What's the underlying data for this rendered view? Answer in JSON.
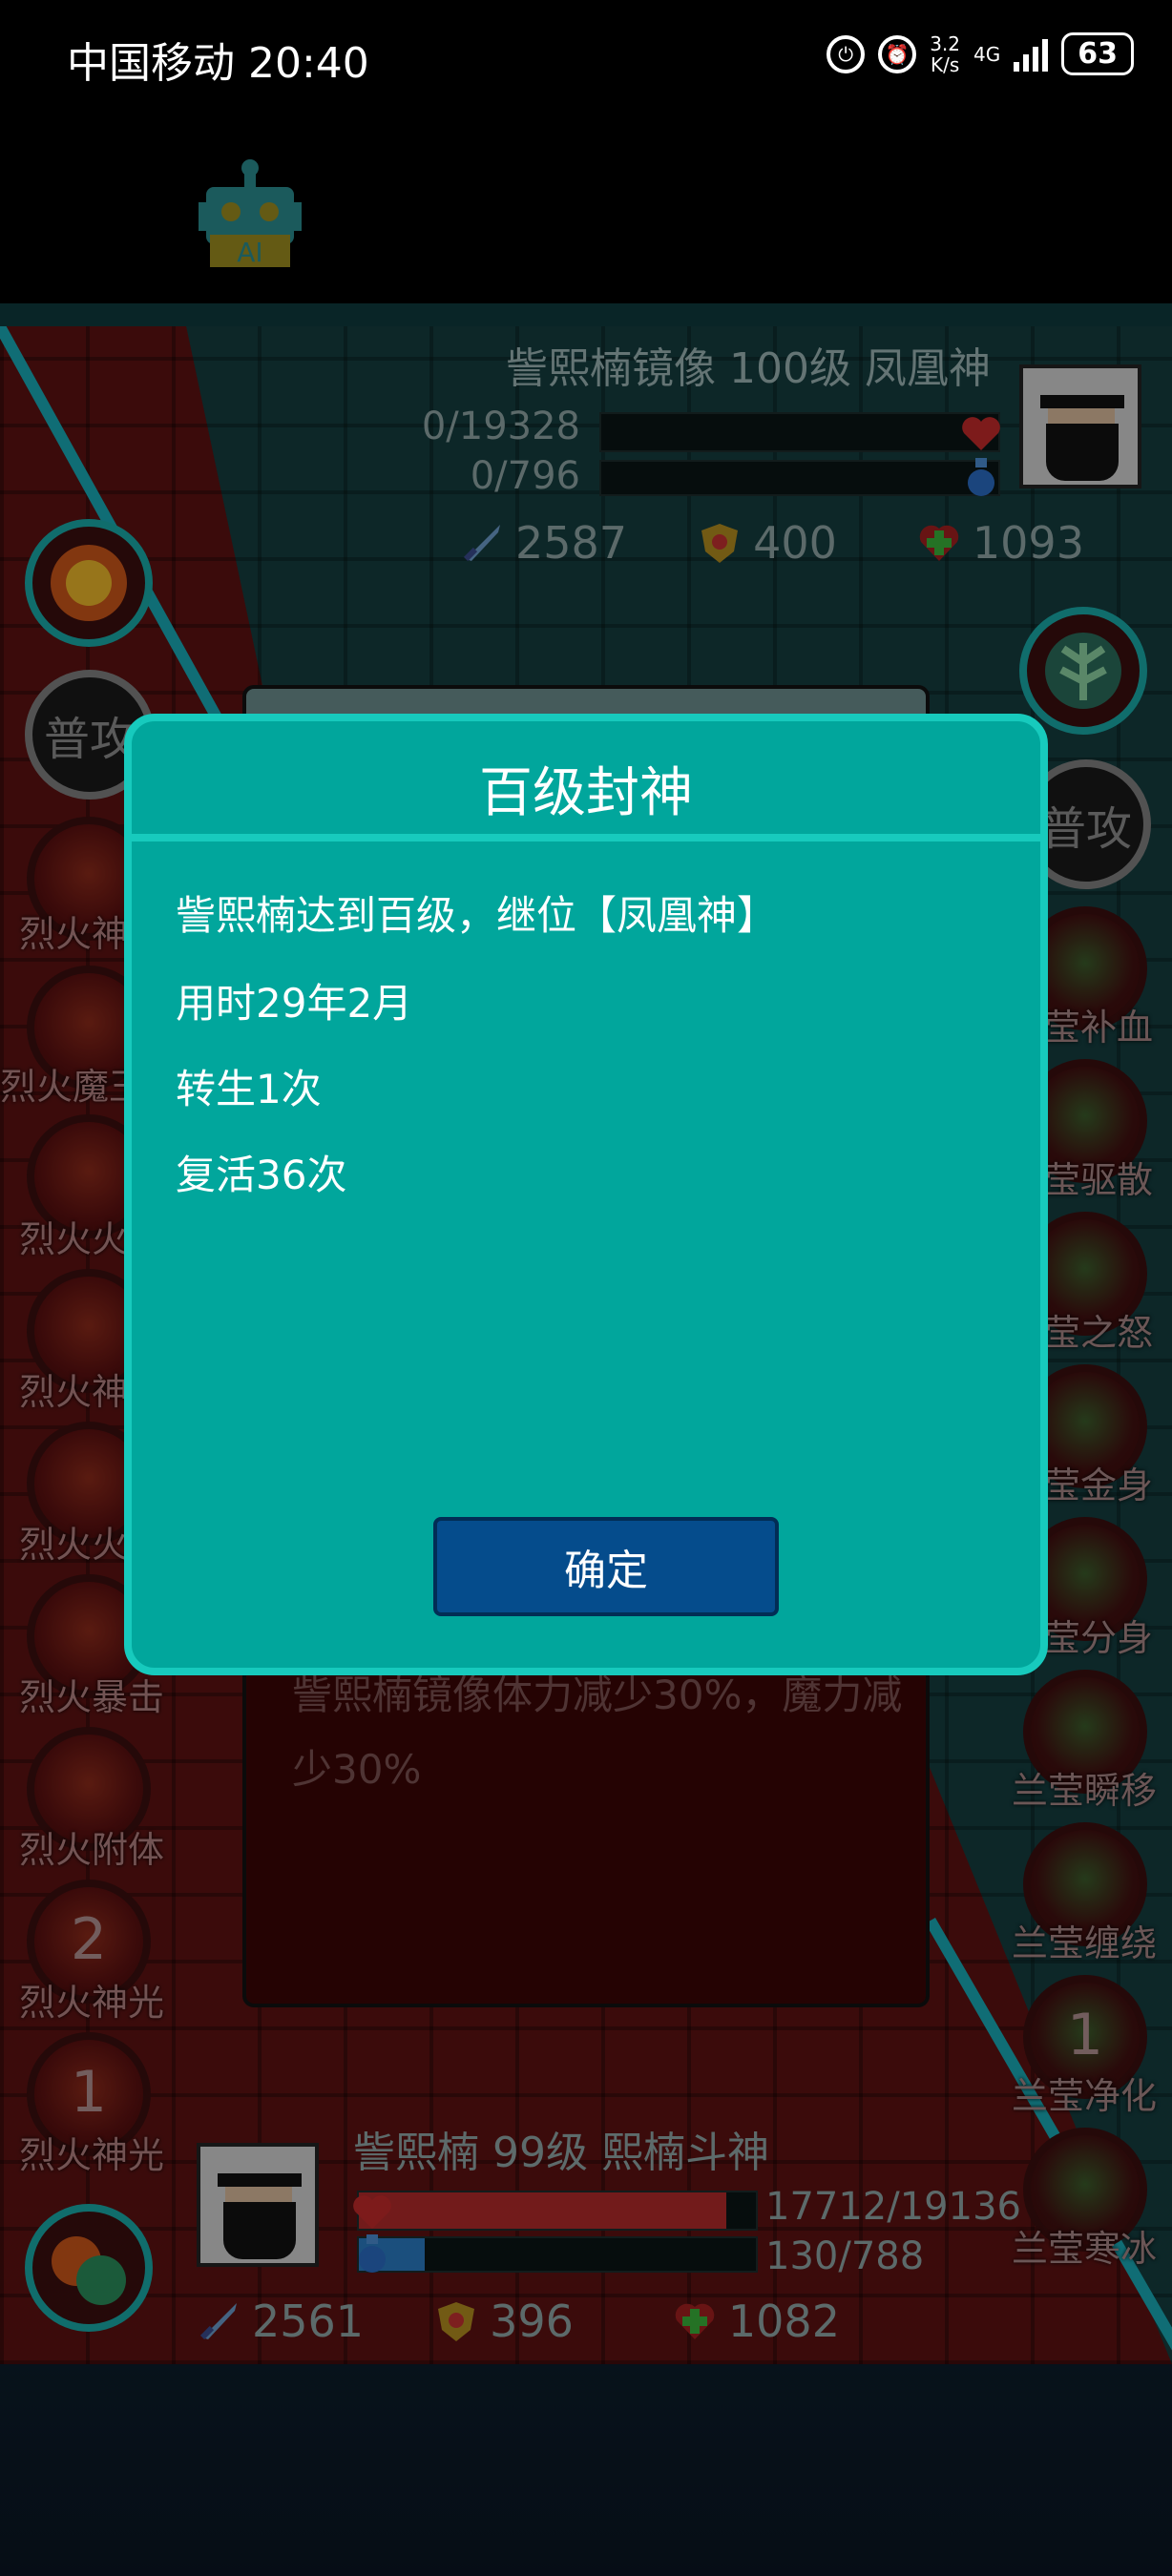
{
  "status_bar": {
    "carrier_time": "中国移动 20:40",
    "speed_top": "3.2",
    "speed_unit": "K/s",
    "network": "4G",
    "battery": "63"
  },
  "enemy": {
    "name": "訾熙楠镜像 100级 凤凰神",
    "hp": "0/19328",
    "mp": "0/796",
    "attack": "2587",
    "defense": "400",
    "heal": "1093"
  },
  "left_skills": [
    "普攻",
    "烈火神",
    "烈火魔王",
    "烈火火",
    "烈火神",
    "烈火火",
    "烈火暴击",
    "烈火附体",
    "烈火神光",
    "烈火神光"
  ],
  "left_cooldowns": [
    "2",
    "1"
  ],
  "right_skills": [
    "普攻",
    "莹补血",
    "莹驱散",
    "莹之怒",
    "莹金身",
    "莹分身",
    "兰莹瞬移",
    "兰莹缠绕",
    "兰莹净化",
    "兰莹寒冰"
  ],
  "right_cooldowns": [
    "1"
  ],
  "card_text": "訾熙楠镜像体力减少30%，魔力减少30%",
  "player": {
    "name": "訾熙楠 99级 熙楠斗神",
    "hp": "17712/19136",
    "mp": "130/788",
    "hp_fill": 0.926,
    "mp_fill": 0.165,
    "attack": "2561",
    "defense": "396",
    "heal": "1082"
  },
  "dialog": {
    "title": "百级封神",
    "lines": [
      "訾熙楠达到百级，继位【凤凰神】",
      "用时29年2月",
      "转生1次",
      "复活36次"
    ],
    "confirm": "确定"
  },
  "colors": {
    "dialog_bg": "#01a69c",
    "dialog_border": "#17cabd",
    "button_bg": "#054c8c"
  }
}
